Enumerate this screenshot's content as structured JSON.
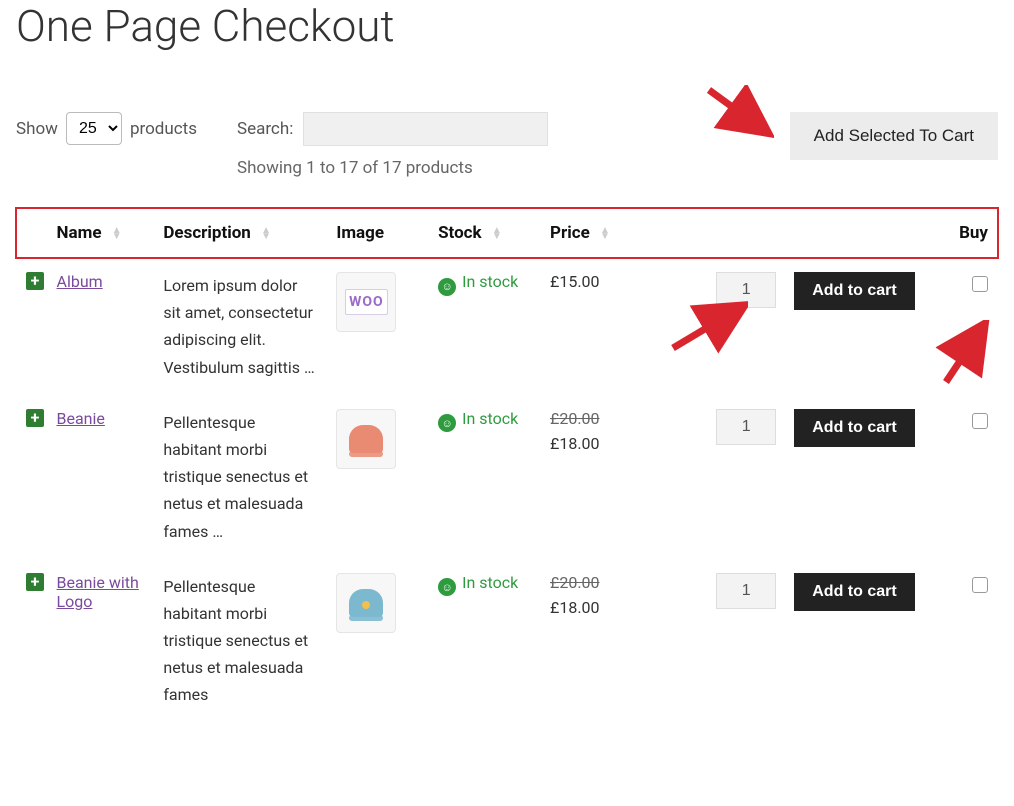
{
  "page": {
    "title": "One Page Checkout"
  },
  "controls": {
    "show_label": "Show",
    "show_value": "25",
    "products_label": "products",
    "search_label": "Search:",
    "search_value": "",
    "showing_text": "Showing 1 to 17 of 17 products",
    "add_selected_label": "Add Selected To Cart"
  },
  "columns": {
    "name": "Name",
    "description": "Description",
    "image": "Image",
    "stock": "Stock",
    "price": "Price",
    "buy": "Buy"
  },
  "rows": [
    {
      "name": "Album",
      "description": "Lorem ipsum dolor sit amet, consectetur adipiscing elit. Vestibulum sagittis …",
      "stock": "In stock",
      "price": "£15.00",
      "qty": "1",
      "add_label": "Add to cart",
      "imgclass": "prod-album",
      "imgtext": "WOO"
    },
    {
      "name": "Beanie",
      "description": "Pellentesque habitant morbi tristique senectus et netus et malesuada fames …",
      "stock": "In stock",
      "price_old": "£20.00",
      "price": "£18.00",
      "qty": "1",
      "add_label": "Add to cart",
      "imgclass": "prod-beanie"
    },
    {
      "name": "Beanie with Logo",
      "description": "Pellentesque habitant morbi tristique senectus et netus et malesuada fames",
      "stock": "In stock",
      "price_old": "£20.00",
      "price": "£18.00",
      "qty": "1",
      "add_label": "Add to cart",
      "imgclass": "prod-beanie2"
    }
  ]
}
